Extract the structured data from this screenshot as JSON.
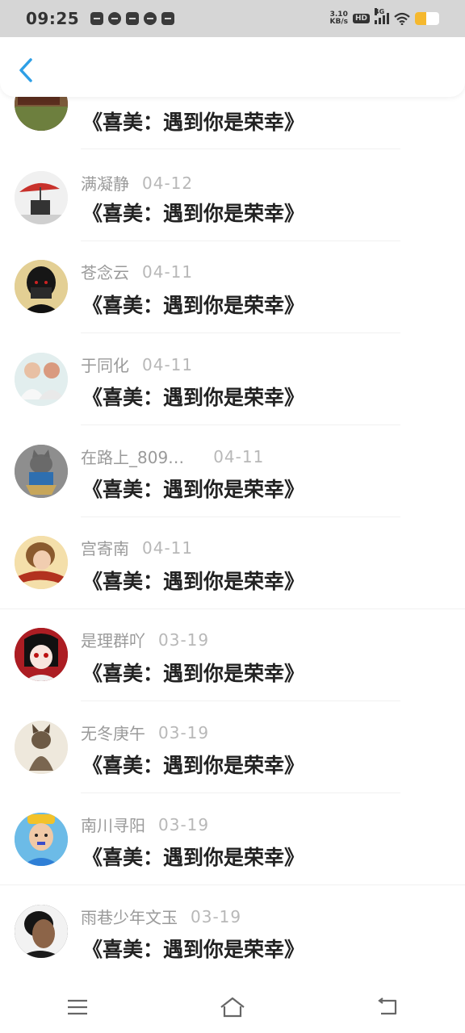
{
  "status_bar": {
    "time": "09:25",
    "net_speed_value": "3.10",
    "net_speed_unit": "KB/s",
    "hd_label": "HD",
    "network_type": "4G",
    "battery_level": 0.45,
    "icons_left": [
      "gallery-icon",
      "compass-icon",
      "shopping-icon",
      "chat-icon",
      "notes-icon"
    ]
  },
  "header": {
    "back_icon": "chevron-left-icon"
  },
  "colors": {
    "accent": "#2e9fe6",
    "name_gray": "#9a9a9a",
    "title_dark": "#222222"
  },
  "items": [
    {
      "name": "",
      "date": "",
      "title": "《喜美：遇到你是荣幸》",
      "avatar": "brown-box-avatar"
    },
    {
      "name": "满凝静",
      "date": "04-12",
      "title": "《喜美：遇到你是荣幸》",
      "avatar": "umbrella-avatar"
    },
    {
      "name": "苍念云",
      "date": "04-11",
      "title": "《喜美：遇到你是荣幸》",
      "avatar": "masked-boy-avatar"
    },
    {
      "name": "于同化",
      "date": "04-11",
      "title": "《喜美：遇到你是荣幸》",
      "avatar": "couple-avatar"
    },
    {
      "name": "在路上_809…",
      "date": "04-11",
      "title": "《喜美：遇到你是荣幸》",
      "avatar": "cat-avatar"
    },
    {
      "name": "宫寄南",
      "date": "04-11",
      "title": "《喜美：遇到你是荣幸》",
      "avatar": "scarf-girl-avatar"
    },
    {
      "name": "是理群吖",
      "date": "03-19",
      "title": "《喜美：遇到你是荣幸》",
      "avatar": "anime-girl-avatar"
    },
    {
      "name": "无冬庚午",
      "date": "03-19",
      "title": "《喜美：遇到你是荣幸》",
      "avatar": "sitting-cat-avatar"
    },
    {
      "name": "南川寻阳",
      "date": "03-19",
      "title": "《喜美：遇到你是荣幸》",
      "avatar": "child-avatar"
    },
    {
      "name": "雨巷少年文玉",
      "date": "03-19",
      "title": "《喜美：遇到你是荣幸》",
      "avatar": "man-portrait-avatar"
    }
  ],
  "nav_bar": {
    "icons": [
      "menu-icon",
      "home-icon",
      "back-icon"
    ]
  }
}
